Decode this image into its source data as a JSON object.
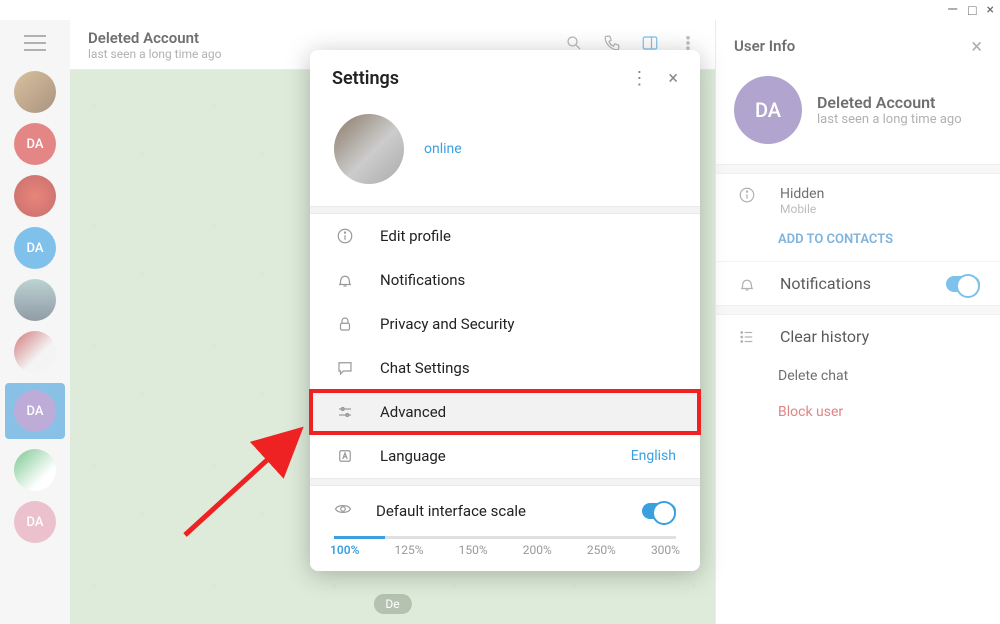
{
  "window": {
    "min": "—",
    "max": "□",
    "close": "×"
  },
  "ribbon": {
    "items": [
      {
        "kind": "photo1"
      },
      {
        "kind": "DA-red",
        "label": "DA"
      },
      {
        "kind": "photo2"
      },
      {
        "kind": "DA-blue",
        "label": "DA"
      },
      {
        "kind": "photo3"
      },
      {
        "kind": "photo4"
      },
      {
        "kind": "DA-purple",
        "label": "DA",
        "selected": true
      },
      {
        "kind": "photo5"
      },
      {
        "kind": "DA-pink",
        "label": "DA"
      }
    ]
  },
  "chat": {
    "name": "Deleted Account",
    "status": "last seen a long time ago",
    "date_label": "De"
  },
  "userinfo": {
    "title": "User Info",
    "avatar": "DA",
    "name": "Deleted Account",
    "status": "last seen a long time ago",
    "hidden_label": "Hidden",
    "hidden_sub": "Mobile",
    "add_contacts": "ADD TO CONTACTS",
    "notifications_label": "Notifications",
    "clear_history": "Clear history",
    "delete_chat": "Delete chat",
    "block_user": "Block user"
  },
  "settings": {
    "title": "Settings",
    "status": "online",
    "items": {
      "edit_profile": "Edit profile",
      "notifications": "Notifications",
      "privacy": "Privacy and Security",
      "chat_settings": "Chat Settings",
      "advanced": "Advanced",
      "language": "Language",
      "language_value": "English",
      "default_scale": "Default interface scale"
    },
    "scales": [
      "100%",
      "125%",
      "150%",
      "200%",
      "250%",
      "300%"
    ]
  }
}
